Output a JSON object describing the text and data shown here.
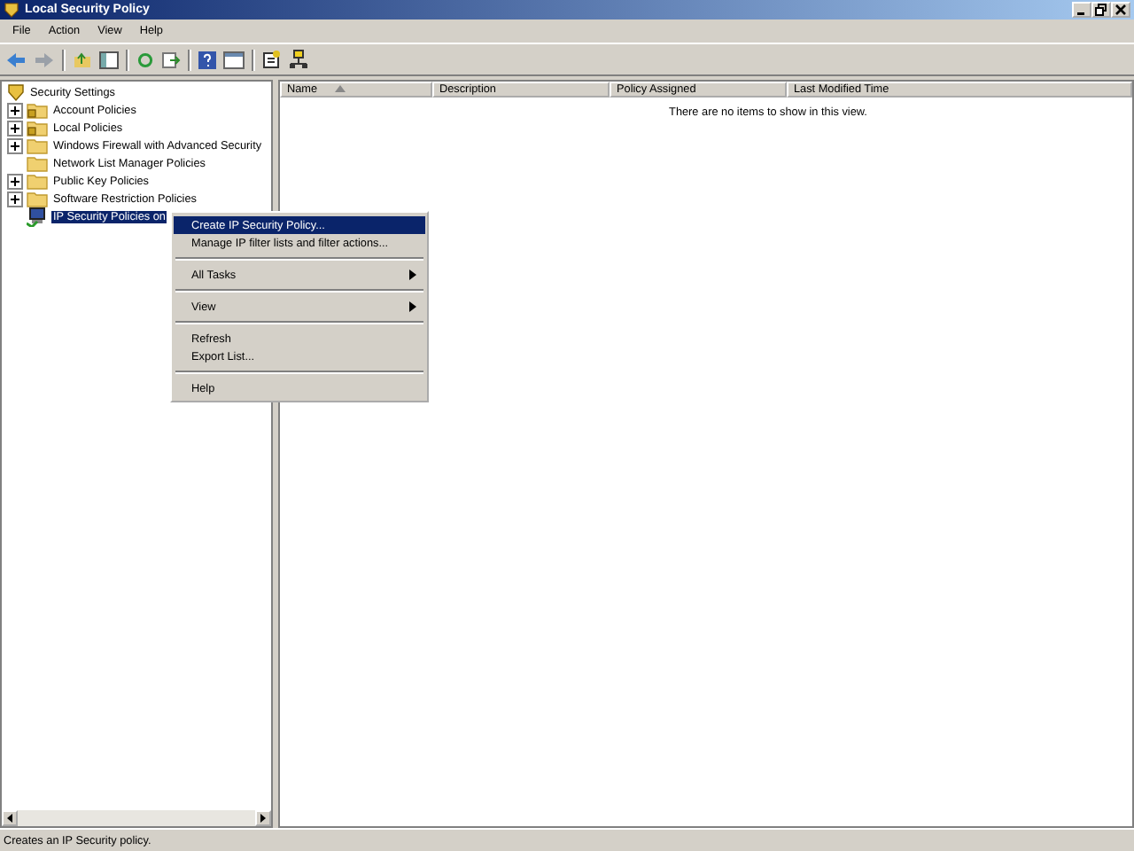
{
  "window": {
    "title": "Local Security Policy"
  },
  "menu_bar": [
    "File",
    "Action",
    "View",
    "Help"
  ],
  "tree": {
    "root": {
      "label": "Security Settings",
      "kind": "shield",
      "selected": false
    },
    "children": [
      {
        "label": "Account Policies",
        "kind": "lock-folder",
        "expandable": true,
        "selected": false
      },
      {
        "label": "Local Policies",
        "kind": "lock-folder",
        "expandable": true,
        "selected": false
      },
      {
        "label": "Windows Firewall with Advanced Security",
        "kind": "folder",
        "expandable": true,
        "selected": false
      },
      {
        "label": "Network List Manager Policies",
        "kind": "folder",
        "expandable": false,
        "selected": false
      },
      {
        "label": "Public Key Policies",
        "kind": "folder",
        "expandable": true,
        "selected": false
      },
      {
        "label": "Software Restriction Policies",
        "kind": "folder",
        "expandable": true,
        "selected": false
      },
      {
        "label": "IP Security Policies on",
        "kind": "computer",
        "expandable": false,
        "selected": true
      }
    ]
  },
  "list": {
    "columns": [
      {
        "label": "Name",
        "sorted": true
      },
      {
        "label": "Description",
        "sorted": false
      },
      {
        "label": "Policy Assigned",
        "sorted": false
      },
      {
        "label": "Last Modified Time",
        "sorted": false
      }
    ],
    "empty_text": "There are no items to show in this view."
  },
  "context_menu": [
    {
      "kind": "item",
      "label": "Create IP Security Policy...",
      "selected": true,
      "submenu": false
    },
    {
      "kind": "item",
      "label": "Manage IP filter lists and filter actions...",
      "selected": false,
      "submenu": false
    },
    {
      "kind": "separator"
    },
    {
      "kind": "item",
      "label": "All Tasks",
      "selected": false,
      "submenu": true
    },
    {
      "kind": "separator"
    },
    {
      "kind": "item",
      "label": "View",
      "selected": false,
      "submenu": true
    },
    {
      "kind": "separator"
    },
    {
      "kind": "item",
      "label": "Refresh",
      "selected": false,
      "submenu": false
    },
    {
      "kind": "item",
      "label": "Export List...",
      "selected": false,
      "submenu": false
    },
    {
      "kind": "separator"
    },
    {
      "kind": "item",
      "label": "Help",
      "selected": false,
      "submenu": false
    }
  ],
  "status_bar": "Creates an IP Security policy."
}
